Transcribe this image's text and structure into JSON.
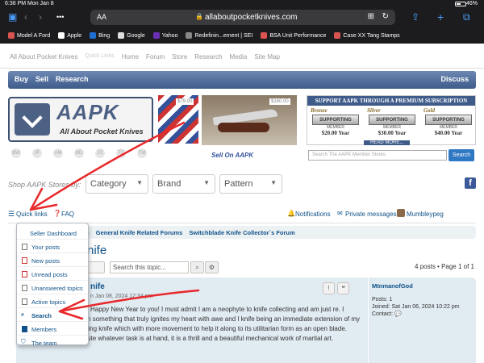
{
  "status": {
    "time": "6:36 PM",
    "date": "Mon Jan 8",
    "battery": "46%"
  },
  "browser": {
    "aa_label": "AA",
    "url": "allaboutpocketknives.com",
    "bookmarks": [
      "Model A Ford",
      "Apple",
      "Bing",
      "Google",
      "Yahoo",
      "Redefinin...ement | SEI",
      "BSA Unit Performance",
      "Case XX Tang Stamps"
    ],
    "bookmark_colors": [
      "#d9534f",
      "#ffffff",
      "#1f6fd1",
      "#dddddd",
      "#6b2fb3",
      "#888888",
      "#d9534f",
      "#d9534f"
    ]
  },
  "site": {
    "topnav": [
      "All About Pocket Knives",
      "Quick Links",
      "Home",
      "Forum",
      "Store",
      "Research",
      "Media",
      "Site Map"
    ],
    "bluebar_left": [
      "Buy",
      "Sell",
      "Research"
    ],
    "bluebar_right": "Discuss",
    "logo_big": "AAPK",
    "logo_tag": "All About Pocket Knives",
    "logo_icons": [
      "BW",
      "JF",
      "AM",
      "BD",
      "JS",
      "TC",
      "TM"
    ],
    "price1": "$79.00",
    "price2": "$180.00",
    "sell_on": "Sell On AAPK",
    "support_head": "SUPPORT AAPK THROUGH A PREMIUM SUBSCRIPTION",
    "tiers": [
      {
        "name": "Bronze",
        "badge": "SUPPORTING",
        "member": "MEMBER",
        "price": "$20.00 Year"
      },
      {
        "name": "Silver",
        "badge": "SUPPORTING",
        "member": "MEMBER",
        "price": "$30.00 Year"
      },
      {
        "name": "Gold",
        "badge": "SUPPORTING",
        "member": "MEMBER",
        "price": "$40.00 Year"
      }
    ],
    "read_more": "READ MORE...",
    "store_search_placeholder": "Search The AAPK Member Stores",
    "store_search_btn": "Search",
    "shop_label": "Shop AAPK Stores by:",
    "filters": [
      "Category",
      "Brand",
      "Pattern"
    ]
  },
  "forum": {
    "quick_links": "Quick links",
    "faq": "FAQ",
    "notifications": "Notifications",
    "private_messages": "Private messages",
    "username": "Mumbleypeg",
    "crumbs": [
      "m",
      "General Knife Related Forums",
      "Switchblade Knife Collector`s Forum"
    ],
    "topic_title": "Knife",
    "search_placeholder": "Search this topic...",
    "page_count": "4 posts • Page 1 of 1",
    "post": {
      "title": "nife",
      "meta": "n Jan 08, 2024 12:34 pm",
      "text": "Happy New Year to you! I must admit I am a neophyte to knife collecting and am just re. I decided to focus first on something that truly ignites my heart with awe and I knife being an immediate extension of my intentions, unlike a folding knife which with more movement to help it along to its utilitarian form as an open blade. When that ped to execute whatever task is at hand, it is a thrill and a beautiful mechanical work of martial art.",
      "author": "MtnmanofGod",
      "posts": "Posts: 1",
      "joined": "Joined: Sat Jan 06, 2024 10:22 pm",
      "contact": "Contact:"
    },
    "dropdown": [
      "Seller Dashboard",
      "Your posts",
      "New posts",
      "Unread posts",
      "Unanswered topics",
      "Active topics",
      "Search",
      "Members",
      "The team"
    ]
  }
}
